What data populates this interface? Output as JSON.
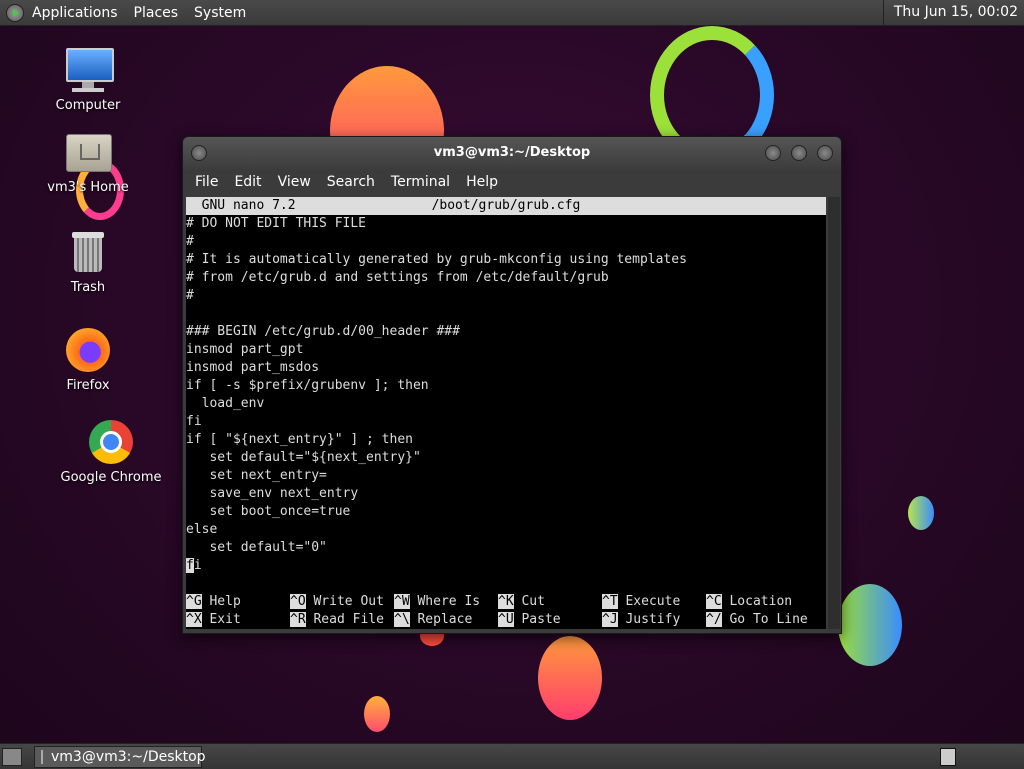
{
  "top_panel": {
    "applications": "Applications",
    "places": "Places",
    "system": "System",
    "clock": "Thu Jun 15, 00:02"
  },
  "desktop": {
    "icons": [
      {
        "label": "Computer"
      },
      {
        "label": "vm3's Home"
      },
      {
        "label": "Trash"
      },
      {
        "label": "Firefox"
      },
      {
        "label": "Google Chrome"
      }
    ]
  },
  "window": {
    "title": "vm3@vm3:~/Desktop",
    "menu": [
      "File",
      "Edit",
      "View",
      "Search",
      "Terminal",
      "Help"
    ]
  },
  "nano": {
    "version": "  GNU nano 7.2",
    "filename": "/boot/grub/grub.cfg",
    "lines": [
      "# DO NOT EDIT THIS FILE",
      "#",
      "# It is automatically generated by grub-mkconfig using templates",
      "# from /etc/grub.d and settings from /etc/default/grub",
      "#",
      "",
      "### BEGIN /etc/grub.d/00_header ###",
      "insmod part_gpt",
      "insmod part_msdos",
      "if [ -s $prefix/grubenv ]; then",
      "  load_env",
      "fi",
      "if [ \"${next_entry}\" ] ; then",
      "   set default=\"${next_entry}\"",
      "   set next_entry=",
      "   save_env next_entry",
      "   set boot_once=true",
      "else",
      "   set default=\"0\""
    ],
    "cursor_line_char": "f",
    "cursor_line_rest": "i",
    "shortcuts_row1": [
      {
        "key": "^G",
        "label": "Help"
      },
      {
        "key": "^O",
        "label": "Write Out"
      },
      {
        "key": "^W",
        "label": "Where Is"
      },
      {
        "key": "^K",
        "label": "Cut"
      },
      {
        "key": "^T",
        "label": "Execute"
      },
      {
        "key": "^C",
        "label": "Location"
      }
    ],
    "shortcuts_row2": [
      {
        "key": "^X",
        "label": "Exit"
      },
      {
        "key": "^R",
        "label": "Read File"
      },
      {
        "key": "^\\",
        "label": "Replace"
      },
      {
        "key": "^U",
        "label": "Paste"
      },
      {
        "key": "^J",
        "label": "Justify"
      },
      {
        "key": "^/",
        "label": "Go To Line"
      }
    ]
  },
  "taskbar": {
    "task_label": "vm3@vm3:~/Desktop"
  },
  "colors": {
    "background": "#2a0828",
    "panel": "#3d3d3d",
    "terminal_bg": "#000000",
    "terminal_fg": "#dddddd"
  }
}
